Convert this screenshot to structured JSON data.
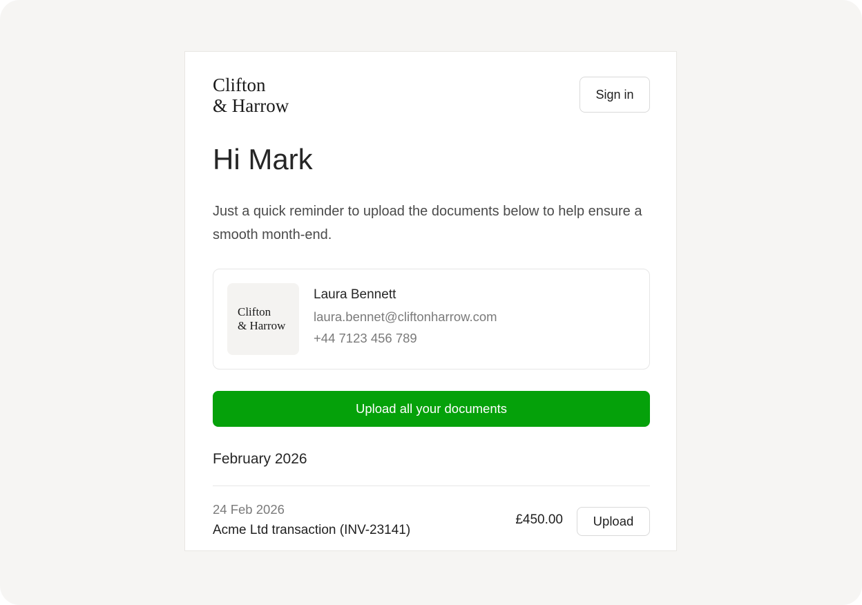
{
  "brand": {
    "line1": "Clifton",
    "line2": "& Harrow"
  },
  "header": {
    "sign_in_label": "Sign in"
  },
  "greeting": "Hi Mark",
  "intro": "Just a quick reminder to upload the documents below to help ensure a smooth month-end.",
  "contact": {
    "logo_line1": "Clifton",
    "logo_line2": "& Harrow",
    "name": "Laura Bennett",
    "email": "laura.bennet@cliftonharrow.com",
    "phone": "+44 7123 456 789"
  },
  "cta": {
    "upload_all_label": "Upload all your documents"
  },
  "section": {
    "month": "February 2026"
  },
  "transactions": [
    {
      "date": "24 Feb 2026",
      "description": "Acme Ltd transaction (INV-23141)",
      "amount": "£450.00",
      "action_label": "Upload"
    }
  ],
  "colors": {
    "accent_green": "#05a10a",
    "frame_background": "#f6f5f3"
  }
}
